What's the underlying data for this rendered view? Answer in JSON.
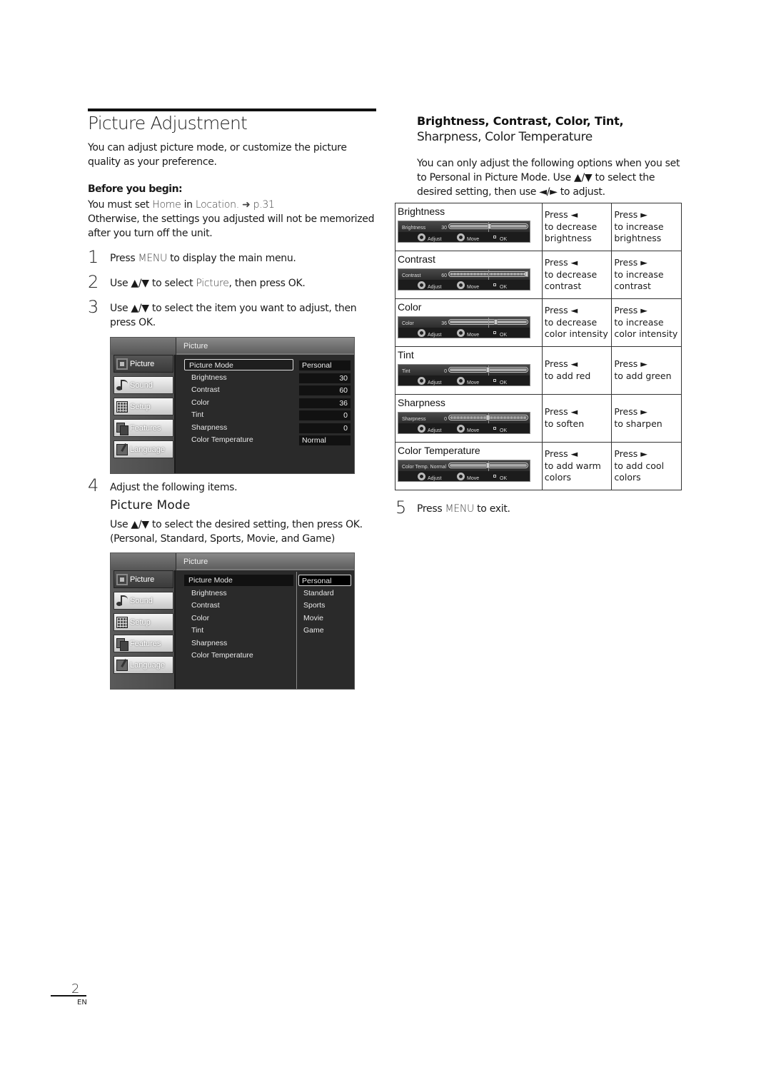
{
  "page": {
    "title": "Picture Adjustment",
    "intro": "You can adjust picture mode, or customize the picture quality as your preference.",
    "before_label": "Before you begin:",
    "before_line1_pre": "You must set ",
    "before_line1_home": "Home",
    "before_line1_mid": " in ",
    "before_line1_location": "Location",
    "before_line1_ref": ". ➜ p.31",
    "before_line2": "Otherwise, the settings you adjusted will not be memorized after you turn off the unit.",
    "page_number": "2",
    "language": "EN"
  },
  "steps": [
    {
      "num": "1",
      "pre": "Press ",
      "key": "MENU",
      "post": " to display the main menu."
    },
    {
      "num": "2",
      "pre": "Use ▲/▼ to select ",
      "key": "Picture",
      "post": ", then press OK."
    },
    {
      "num": "3",
      "text": "Use ▲/▼ to select the item you want to adjust, then press OK."
    },
    {
      "num": "4",
      "text": "Adjust the following items."
    },
    {
      "num": "5",
      "pre": "Press ",
      "key": "MENU",
      "post": " to exit."
    }
  ],
  "picture_mode": {
    "heading": "Picture Mode",
    "instruction": "Use ▲/▼ to select the desired setting, then press OK.",
    "options_line": "(Personal, Standard, Sports, Movie, and Game)"
  },
  "tv_menu_1": {
    "header": "Picture",
    "sidebar": [
      "Picture",
      "Sound",
      "Setup",
      "Features",
      "Language"
    ],
    "items": [
      {
        "label": "Picture Mode",
        "value": "Personal"
      },
      {
        "label": "Brightness",
        "value": "30"
      },
      {
        "label": "Contrast",
        "value": "60"
      },
      {
        "label": "Color",
        "value": "36"
      },
      {
        "label": "Tint",
        "value": "0"
      },
      {
        "label": "Sharpness",
        "value": "0"
      },
      {
        "label": "Color Temperature",
        "value": "Normal"
      }
    ]
  },
  "tv_menu_2": {
    "header": "Picture",
    "sidebar": [
      "Picture",
      "Sound",
      "Setup",
      "Features",
      "Language"
    ],
    "items": [
      "Picture Mode",
      "Brightness",
      "Contrast",
      "Color",
      "Tint",
      "Sharpness",
      "Color Temperature"
    ],
    "options": [
      "Personal",
      "Standard",
      "Sports",
      "Movie",
      "Game"
    ],
    "selected_option": "Personal"
  },
  "right": {
    "heading_bold": "Brightness, Contrast, Color, Tint,",
    "heading_light": "Sharpness, Color Temperature",
    "intro": "You can only adjust the following options when you set to Personal in Picture Mode. Use ▲/▼ to select the desired setting, then use ◄/► to adjust."
  },
  "adjust_table": [
    {
      "title": "Brightness",
      "osd_label": "Brightness",
      "osd_value": "30",
      "level": 0.52,
      "striped": false,
      "dec_press": "Press ◄",
      "dec_text": "to decrease brightness",
      "inc_press": "Press ►",
      "inc_text": "to increase brightness"
    },
    {
      "title": "Contrast",
      "osd_label": "Contrast",
      "osd_value": "60",
      "level": 1.0,
      "striped": true,
      "dec_press": "Press ◄",
      "dec_text": "to decrease contrast",
      "inc_press": "Press ►",
      "inc_text": "to increase contrast"
    },
    {
      "title": "Color",
      "osd_label": "Color",
      "osd_value": "36",
      "level": 0.6,
      "striped": false,
      "dec_press": "Press ◄",
      "dec_text": "to decrease color intensity",
      "inc_press": "Press ►",
      "inc_text": "to increase color intensity"
    },
    {
      "title": "Tint",
      "osd_label": "Tint",
      "osd_value": "0",
      "level": 0.5,
      "striped": false,
      "dec_press": "Press ◄",
      "dec_text": "to add red",
      "inc_press": "Press ►",
      "inc_text": "to add green"
    },
    {
      "title": "Sharpness",
      "osd_label": "Sharpness",
      "osd_value": "0",
      "level": 0.5,
      "striped": true,
      "dec_press": "Press ◄",
      "dec_text": "to soften",
      "inc_press": "Press ►",
      "inc_text": "to sharpen"
    },
    {
      "title": "Color Temperature",
      "osd_label": "Color Temp. Normal",
      "osd_value": "",
      "level": 0.5,
      "striped": false,
      "dec_press": "Press ◄",
      "dec_text": "to add warm colors",
      "inc_press": "Press ►",
      "inc_text": "to add cool colors"
    }
  ],
  "osd_hints": {
    "adjust": "Adjust",
    "move": "Move",
    "ok": "OK"
  }
}
